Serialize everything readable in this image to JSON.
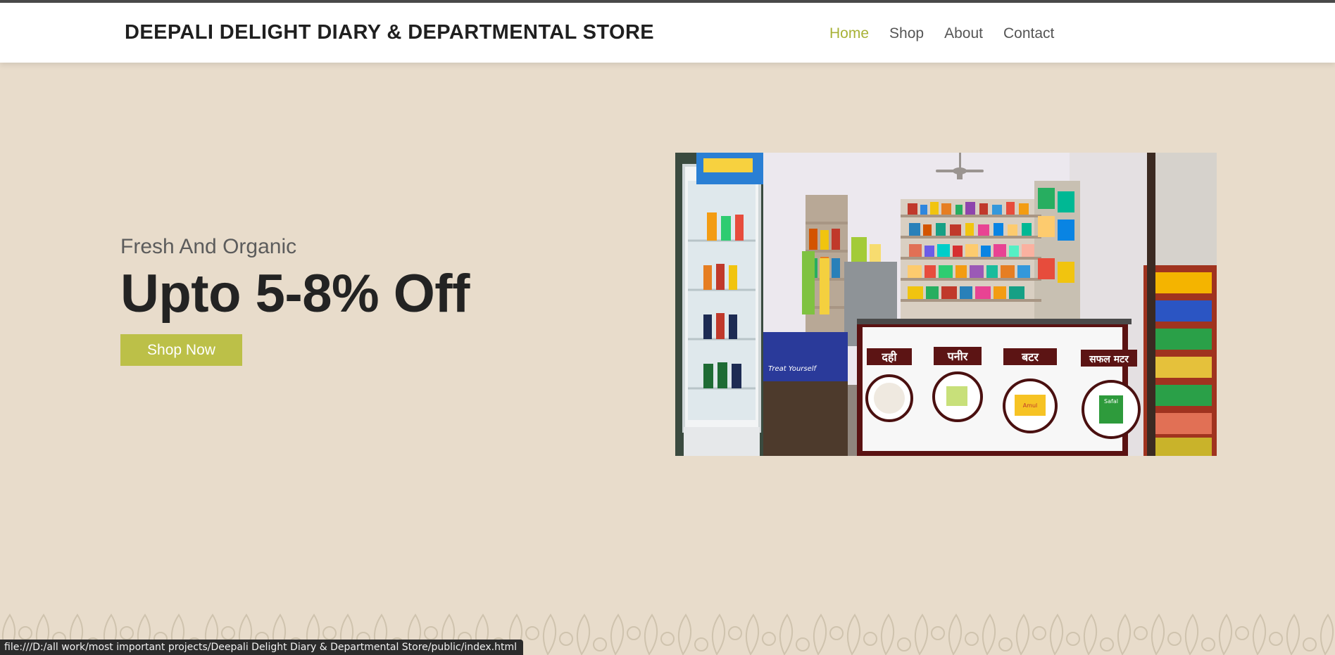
{
  "header": {
    "brand": "DEEPALI DELIGHT DIARY & DEPARTMENTAL STORE",
    "nav": [
      {
        "label": "Home",
        "active": true
      },
      {
        "label": "Shop",
        "active": false
      },
      {
        "label": "About",
        "active": false
      },
      {
        "label": "Contact",
        "active": false
      }
    ]
  },
  "hero": {
    "subtitle": "Fresh And Organic",
    "title": "Upto 5-8% Off",
    "cta_label": "Shop Now",
    "image": {
      "signs": [
        "दही",
        "पनीर",
        "बटर",
        "सफल मटर"
      ],
      "fridge_caption": "Treat Yourself",
      "pack_labels": [
        "Amul",
        "Safal"
      ]
    }
  },
  "status_bar": {
    "url": "file:///D:/all work/most important projects/Deepali Delight Diary & Departmental Store/public/index.html"
  },
  "colors": {
    "accent": "#bcc048",
    "nav_active": "#a8b237",
    "page_bg": "#e8dccb",
    "header_bg": "#ffffff"
  }
}
